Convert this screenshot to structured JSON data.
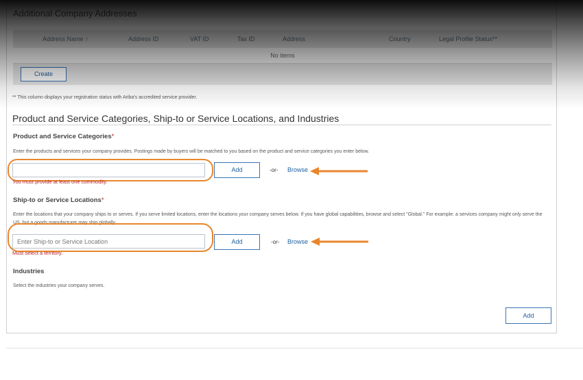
{
  "addresses": {
    "title": "Additional Company Addresses",
    "columns": [
      "Address Name ↑",
      "Address ID",
      "VAT ID",
      "Tax ID",
      "Address",
      "Country",
      "Legal Profile Status**"
    ],
    "empty_text": "No items",
    "create_label": "Create",
    "footnote": "** This column displays your registration status with Ariba's accredited service provider."
  },
  "section": {
    "title": "Product and Service Categories, Ship-to or Service Locations, and Industries"
  },
  "product": {
    "title": "Product and Service Categories",
    "required_mark": "*",
    "hint": "Enter the products and services your company provides. Postings made by buyers will be matched to you based on the product and service categories you enter below.",
    "input_value": "",
    "add_label": "Add",
    "or_label": "-or-",
    "browse_label": "Browse",
    "error": "You must provide at least one commodity."
  },
  "shipto": {
    "title": "Ship-to or Service Locations",
    "required_mark": "*",
    "hint": "Enter the locations that your company ships to or serves. If you serve limited locations, enter the locations your company serves below. If you have global capabilities, browse and select \"Global.\" For example: a services company might only serve the US, but a goods manufacturer may ship globally.",
    "input_placeholder": "Enter Ship-to or Service Location",
    "add_label": "Add",
    "or_label": "-or-",
    "browse_label": "Browse",
    "error": "Must select a territory."
  },
  "industries": {
    "title": "Industries",
    "hint": "Select the industries your company serves.",
    "add_label": "Add"
  },
  "colors": {
    "accent": "#1f5f9f",
    "highlight": "#e9862c",
    "error": "#b22222"
  },
  "icons": [
    "sort-up-arrow",
    "orange-arrow-left-icon"
  ]
}
